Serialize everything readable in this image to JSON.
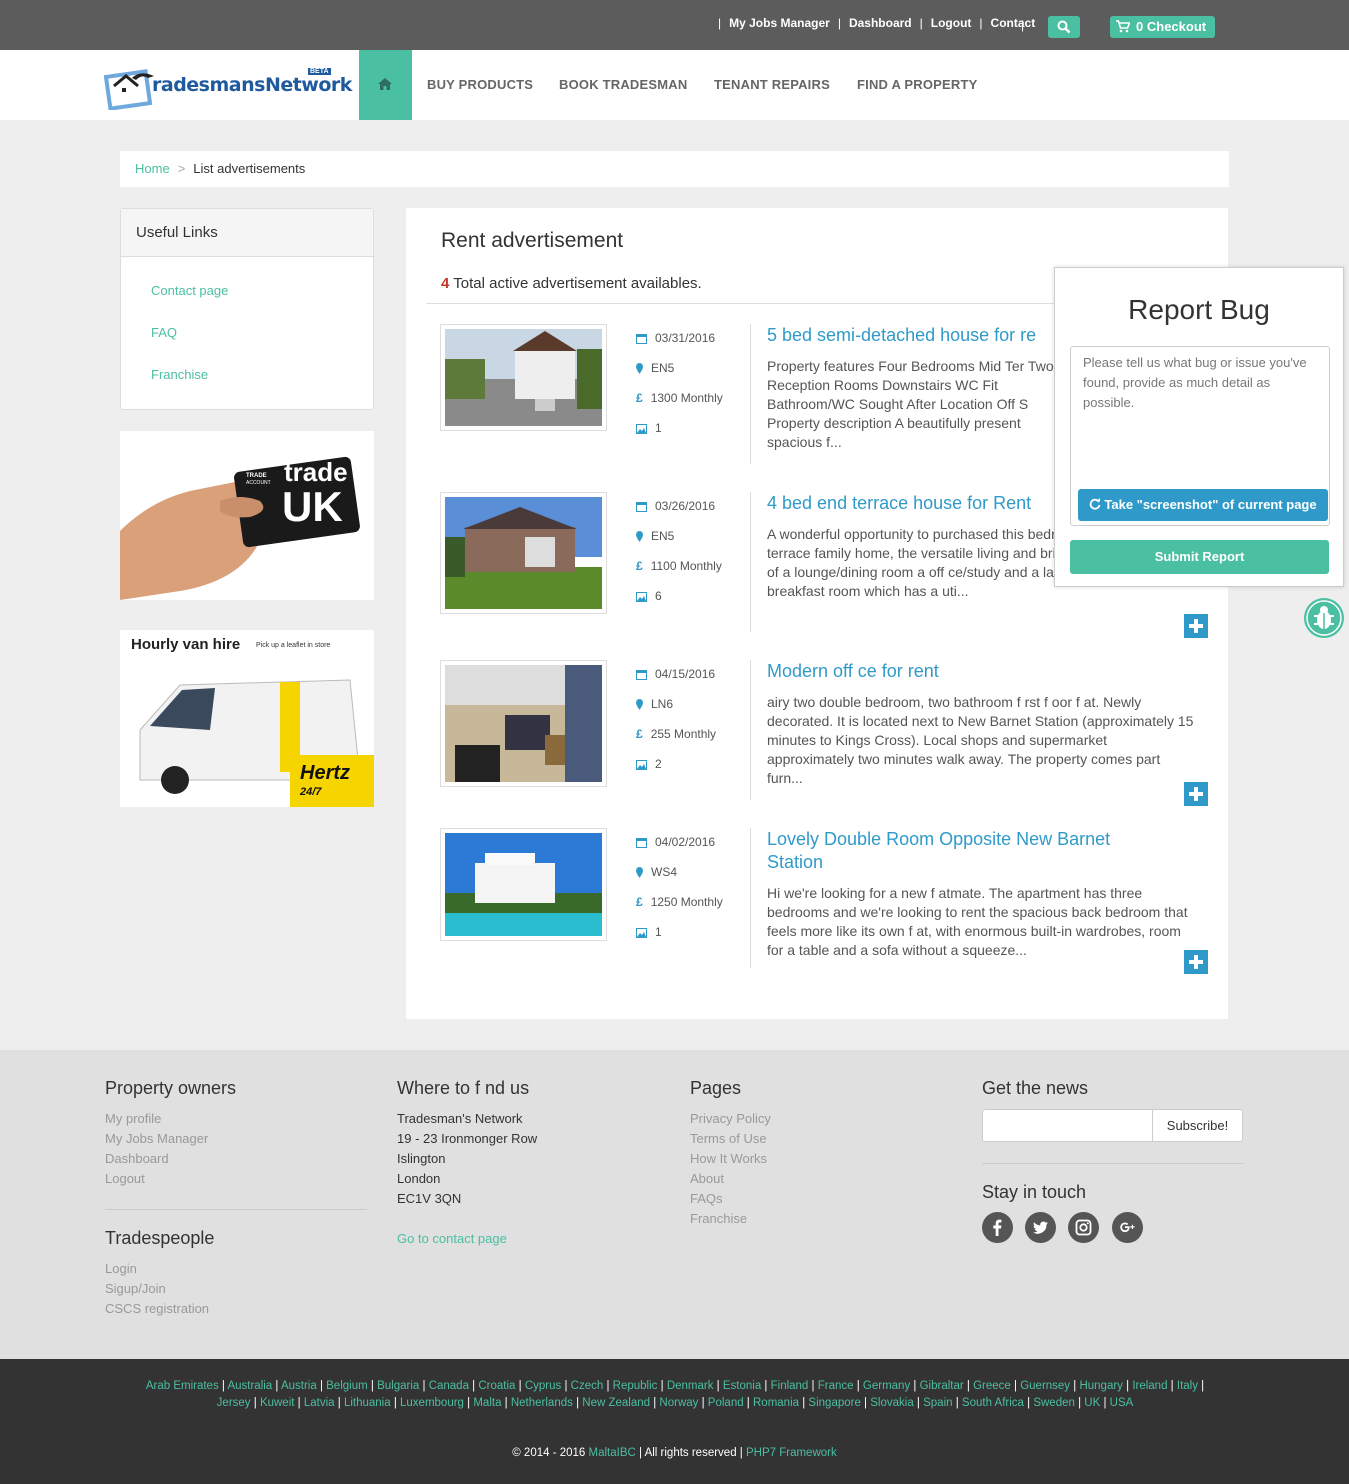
{
  "topbar": {
    "links": [
      "My Jobs Manager",
      "Dashboard",
      "Logout",
      "Contact"
    ],
    "separator": "|",
    "checkout_count": "0",
    "checkout_label": "Checkout"
  },
  "nav": {
    "logo_text": "radesmansNetwork",
    "logo_badge": "BETA",
    "items": [
      "BUY PRODUCTS",
      "BOOK TRADESMAN",
      "TENANT REPAIRS",
      "FIND A PROPERTY"
    ]
  },
  "breadcrumb": {
    "home": "Home",
    "separator": ">",
    "current": "List advertisements"
  },
  "sidebar": {
    "title": "Useful Links",
    "links": [
      "Contact page",
      "FAQ",
      "Franchise"
    ],
    "ad_trade": {
      "line1": "TRADE",
      "line2": "ACCOUNT",
      "brand1": "trade",
      "brand2": "UK"
    },
    "ad_van": {
      "title": "Hourly van hire",
      "subtitle": "Pick up a leaflet in store",
      "brand": "Hertz",
      "brand_sub": "24/7"
    }
  },
  "main": {
    "title": "Rent advertisement",
    "count": "4",
    "count_text": "Total active advertisement availables."
  },
  "listings": [
    {
      "date": "03/31/2016",
      "postcode": "EN5",
      "price": "1300 Monthly",
      "photos": "1",
      "title": "5 bed semi-detached house for re",
      "desc": "Property features Four Bedrooms Mid Ter Two Reception Rooms Downstairs WC Fit Bathroom/WC Sought After Location Off S Property description A beautifully present spacious f..."
    },
    {
      "date": "03/26/2016",
      "postcode": "EN5",
      "price": "1100 Monthly",
      "photos": "6",
      "title": "4 bed end terrace house for Rent",
      "desc": "A wonderful opportunity to purchased this bedroom end of terrace family home, the versatile living and brief y comprises of a lounge/dining room a off ce/study and a large kitchen-breakfast room which has a uti..."
    },
    {
      "date": "04/15/2016",
      "postcode": "LN6",
      "price": "255 Monthly",
      "photos": "2",
      "title": "Modern off ce for rent",
      "desc": "airy two double bedroom, two bathroom f rst f oor f at. Newly decorated. It is located next to New Barnet Station (approximately 15 minutes to Kings Cross). Local shops and supermarket approximately two minutes walk away. The property comes part furn..."
    },
    {
      "date": "04/02/2016",
      "postcode": "WS4",
      "price": "1250 Monthly",
      "photos": "1",
      "title": "Lovely Double Room Opposite New Barnet Station",
      "desc": "Hi we're looking for a new f atmate. The apartment has three bedrooms and we're looking to rent the spacious back bedroom that feels more like its own f at, with enormous built-in wardrobes, room for a table and a sofa without a squeeze..."
    }
  ],
  "report": {
    "title": "Report Bug",
    "placeholder": "Please tell us what bug or issue you've found, provide as much detail as possible.",
    "screenshot_label": "Take \"screenshot\" of current page",
    "submit_label": "Submit Report"
  },
  "footer": {
    "owners": {
      "title": "Property owners",
      "items": [
        "My profile",
        "My Jobs Manager",
        "Dashboard",
        "Logout"
      ]
    },
    "trades": {
      "title": "Tradespeople",
      "items": [
        "Login",
        "Sigup/Join",
        "CSCS registration"
      ]
    },
    "where": {
      "title": "Where to f nd us",
      "address": [
        "Tradesman's Network",
        "19 - 23 Ironmonger Row",
        "Islington",
        "London",
        "EC1V 3QN"
      ],
      "contact_link": "Go to contact page"
    },
    "pages": {
      "title": "Pages",
      "items": [
        "Privacy Policy",
        "Terms of Use",
        "How It Works",
        "About",
        "FAQs",
        "Franchise"
      ]
    },
    "news": {
      "title": "Get the news",
      "subscribe": "Subscribe!",
      "stay": "Stay in touch"
    }
  },
  "countries": [
    "Arab Emirates",
    "Australia",
    "Austria",
    "Belgium",
    "Bulgaria",
    "Canada",
    "Croatia",
    "Cyprus",
    "Czech",
    "Republic",
    "Denmark",
    "Estonia",
    "Finland",
    "France",
    "Germany",
    "Gibraltar",
    "Greece",
    "Guernsey",
    "Hungary",
    "Ireland",
    "Italy",
    "Jersey",
    "Kuweit",
    "Latvia",
    "Lithuania",
    "Luxembourg",
    "Malta",
    "Netherlands",
    "New Zealand",
    "Norway",
    "Poland",
    "Romania",
    "Singapore",
    "Slovakia",
    "Spain",
    "South Africa",
    "Sweden",
    "UK",
    "USA"
  ],
  "copyright": {
    "text": "© 2014 - 2016",
    "company": "MaltaIBC",
    "rights": "| All rights reserved |",
    "framework": "PHP7 Framework"
  },
  "colors": {
    "accent": "#4bbfa1",
    "link_blue": "#2f9ac9",
    "topbar": "#5c5c5c",
    "count_red": "#c0392b"
  }
}
